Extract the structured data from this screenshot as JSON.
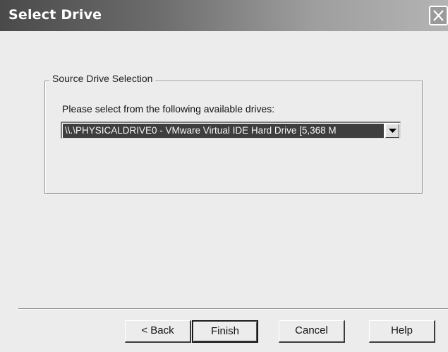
{
  "window": {
    "title": "Select Drive"
  },
  "group": {
    "legend": "Source Drive Selection",
    "prompt": "Please select from the following available drives:"
  },
  "drive_select": {
    "selected_value": "\\\\.\\PHYSICALDRIVE0 - VMware Virtual IDE Hard Drive [5,368 M"
  },
  "buttons": {
    "back_label": "< Back",
    "finish_label": "Finish",
    "cancel_label": "Cancel",
    "help_label": "Help"
  },
  "icons": {
    "close": "close-icon",
    "dropdown": "chevron-down-icon"
  },
  "colors": {
    "titlebar_dark": "#4a4a4a",
    "titlebar_light": "#b4b4b4",
    "dialog_bg": "#ececec",
    "selection_bg": "#3e3e3e"
  }
}
